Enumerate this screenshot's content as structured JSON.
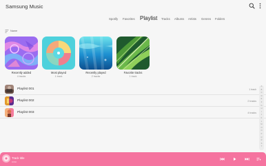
{
  "app": {
    "title": "Samsung Music"
  },
  "tabs": [
    {
      "label": "Spotify"
    },
    {
      "label": "Favorites"
    },
    {
      "label": "Playlist",
      "active": true
    },
    {
      "label": "Tracks"
    },
    {
      "label": "Albums"
    },
    {
      "label": "Artists"
    },
    {
      "label": "Genres"
    },
    {
      "label": "Folders"
    }
  ],
  "sort": {
    "label": "Name",
    "icon": "sort-icon"
  },
  "cards": [
    {
      "title": "Recently added",
      "subtitle": "4 tracks"
    },
    {
      "title": "Most played",
      "subtitle": "1 track"
    },
    {
      "title": "Recently played",
      "subtitle": "2 tracks"
    },
    {
      "title": "Favorite tracks",
      "subtitle": "1 track"
    }
  ],
  "playlists": [
    {
      "title": "Playlist 001",
      "count": "1 track"
    },
    {
      "title": "Playlist 002",
      "count": "2 tracks"
    },
    {
      "title": "Playlist 003",
      "count": "4 tracks"
    }
  ],
  "index": [
    "A",
    "B",
    "C",
    "D",
    "E",
    "F",
    "G",
    "H",
    "I",
    "J",
    "K",
    "L",
    "M",
    "N",
    "O",
    "P",
    "Q",
    "R",
    "S",
    "T"
  ],
  "player": {
    "title": "Track title",
    "artist": "Artist",
    "accent": "#f5739f"
  },
  "icons": {
    "search": "search-icon",
    "more": "more-vert-icon",
    "previous": "skip-previous-icon",
    "play": "play-icon",
    "next": "skip-next-icon",
    "queue": "queue-icon"
  }
}
